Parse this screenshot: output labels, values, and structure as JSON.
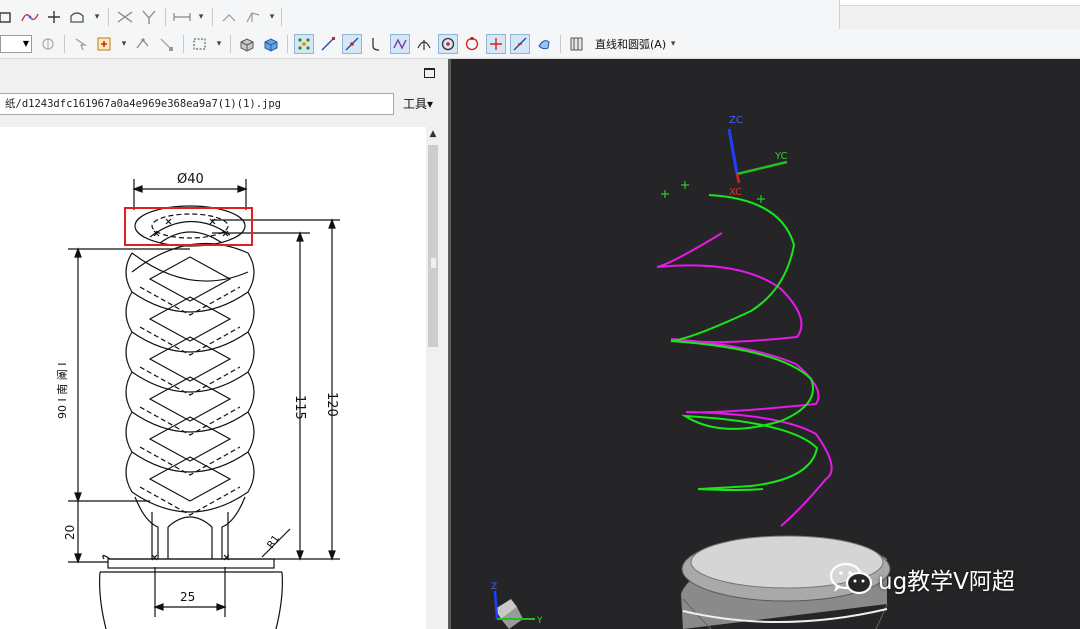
{
  "toolbar_top": {
    "icons": [
      "rectangle-icon",
      "spline-icon",
      "point-icon",
      "area-icon",
      "dropdown-arrow",
      "trim-icon",
      "extend-icon",
      "dimension-icon",
      "dropdown-arrow",
      "constraint-icon",
      "auto-constraint-icon",
      "dropdown-arrow"
    ]
  },
  "toolbar_bottom": {
    "menu_label": "直线和圆弧(A)",
    "dropdown_glyph": "▾"
  },
  "left_panel": {
    "path_text": "纸/d1243dfc161967a0a4e969e368ea9a7(1)(1).jpg",
    "tools_label": "工具▾",
    "drawing": {
      "diameter_label": "Ø40",
      "overall_height": "120",
      "helix_height": "115",
      "helix_pitch_text": "90 I 南 阐 I",
      "base_height": "20",
      "base_width": "25",
      "radius_label": "R1"
    }
  },
  "view3d": {
    "axis_top": {
      "z": "ZC",
      "y": "YC",
      "x": "XC"
    },
    "axis_corner": {
      "z": "Z",
      "y": "Y"
    },
    "colors": {
      "background": "#252527",
      "helix_a": "#19e619",
      "helix_b": "#e619e6"
    }
  },
  "watermark": {
    "text": "ug教学V阿超"
  }
}
